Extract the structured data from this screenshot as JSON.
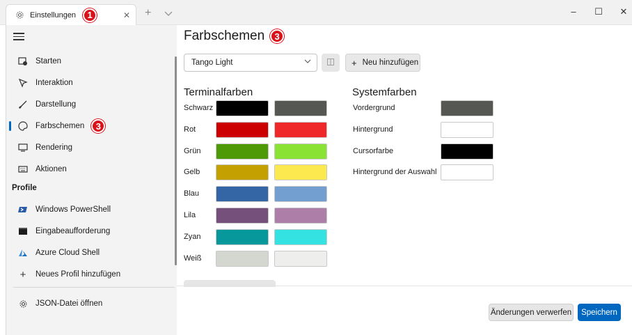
{
  "titlebar": {
    "tab_title": "Einstellungen",
    "tab_badge": "1",
    "icons": {
      "tab": "gear-icon",
      "close": "close-icon",
      "new_tab": "plus-icon",
      "dropdown": "chevron-down-icon"
    }
  },
  "window_controls": {
    "minimize": "–",
    "maximize": "☐",
    "close": "✕"
  },
  "sidebar": {
    "items": [
      {
        "label": "Starten",
        "icon": "startup-icon"
      },
      {
        "label": "Interaktion",
        "icon": "interaction-icon"
      },
      {
        "label": "Darstellung",
        "icon": "brush-icon"
      },
      {
        "label": "Farbschemen",
        "icon": "palette-icon",
        "badge": "3",
        "selected": true
      },
      {
        "label": "Rendering",
        "icon": "monitor-icon"
      },
      {
        "label": "Aktionen",
        "icon": "keyboard-icon"
      }
    ],
    "profile_section": "Profile",
    "profiles": [
      {
        "label": "Windows PowerShell",
        "icon": "powershell-icon"
      },
      {
        "label": "Eingabeaufforderung",
        "icon": "cmd-icon"
      },
      {
        "label": "Azure Cloud Shell",
        "icon": "azure-icon"
      },
      {
        "label": "Neues Profil hinzufügen",
        "icon": "plus-icon"
      }
    ],
    "json": {
      "label": "JSON-Datei öffnen",
      "icon": "gear-icon"
    }
  },
  "main": {
    "title": "Farbschemen",
    "title_badge": "3",
    "scheme_select": "Tango Light",
    "add_button": "Neu hinzufügen",
    "terminal_heading": "Terminalfarben",
    "system_heading": "Systemfarben",
    "terminal_colors": [
      {
        "name": "Schwarz",
        "normal": "#000000",
        "bright": "#555753"
      },
      {
        "name": "Rot",
        "normal": "#cc0000",
        "bright": "#ef2929"
      },
      {
        "name": "Grün",
        "normal": "#4e9a06",
        "bright": "#8ae234"
      },
      {
        "name": "Gelb",
        "normal": "#c4a000",
        "bright": "#fce94f"
      },
      {
        "name": "Blau",
        "normal": "#3465a4",
        "bright": "#729fcf"
      },
      {
        "name": "Lila",
        "normal": "#75507b",
        "bright": "#ad7fa8"
      },
      {
        "name": "Zyan",
        "normal": "#06989a",
        "bright": "#34e2e2"
      },
      {
        "name": "Weiß",
        "normal": "#d3d7cf",
        "bright": "#eeeeec"
      }
    ],
    "system_colors": [
      {
        "name": "Vordergrund",
        "color": "#555753"
      },
      {
        "name": "Hintergrund",
        "color": "#ffffff"
      },
      {
        "name": "Cursorfarbe",
        "color": "#000000"
      },
      {
        "name": "Hintergrund der Auswahl",
        "color": "#ffffff"
      }
    ],
    "discard_button": "Änderungen verwerfen",
    "save_button": "Speichern"
  },
  "colors": {
    "accent": "#0067c0",
    "badge": "#d9111b"
  }
}
